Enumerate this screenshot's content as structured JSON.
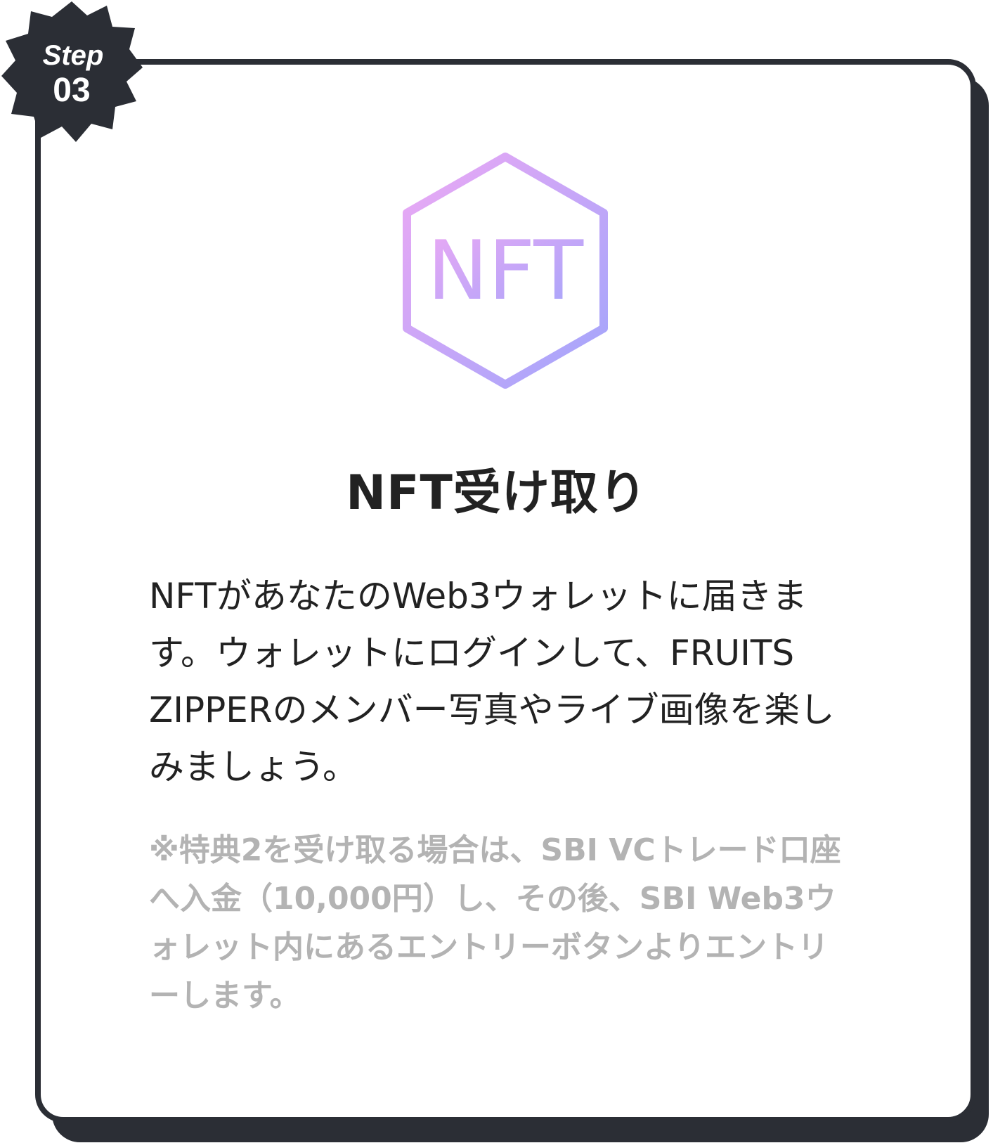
{
  "badge": {
    "step_label": "Step",
    "step_number": "03"
  },
  "icon": {
    "name": "nft-hexagon-icon",
    "text": "NFT",
    "gradient": [
      "#eca8f4",
      "#a9a2fb"
    ]
  },
  "title": "NFT受け取り",
  "description": "NFTがあなたのWeb3ウォレットに届きます。ウォレットにログインして、FRUITS ZIPPERのメンバー写真やライブ画像を楽しみましょう。",
  "note": "※特典2を受け取る場合は、SBI VCトレード口座へ入金（10,000円）し、その後、SBI Web3ウォレット内にあるエントリーボタンよりエントリーします。",
  "colors": {
    "frame": "#2b2e35",
    "text": "#222222",
    "note_text": "#b3b3b3"
  }
}
